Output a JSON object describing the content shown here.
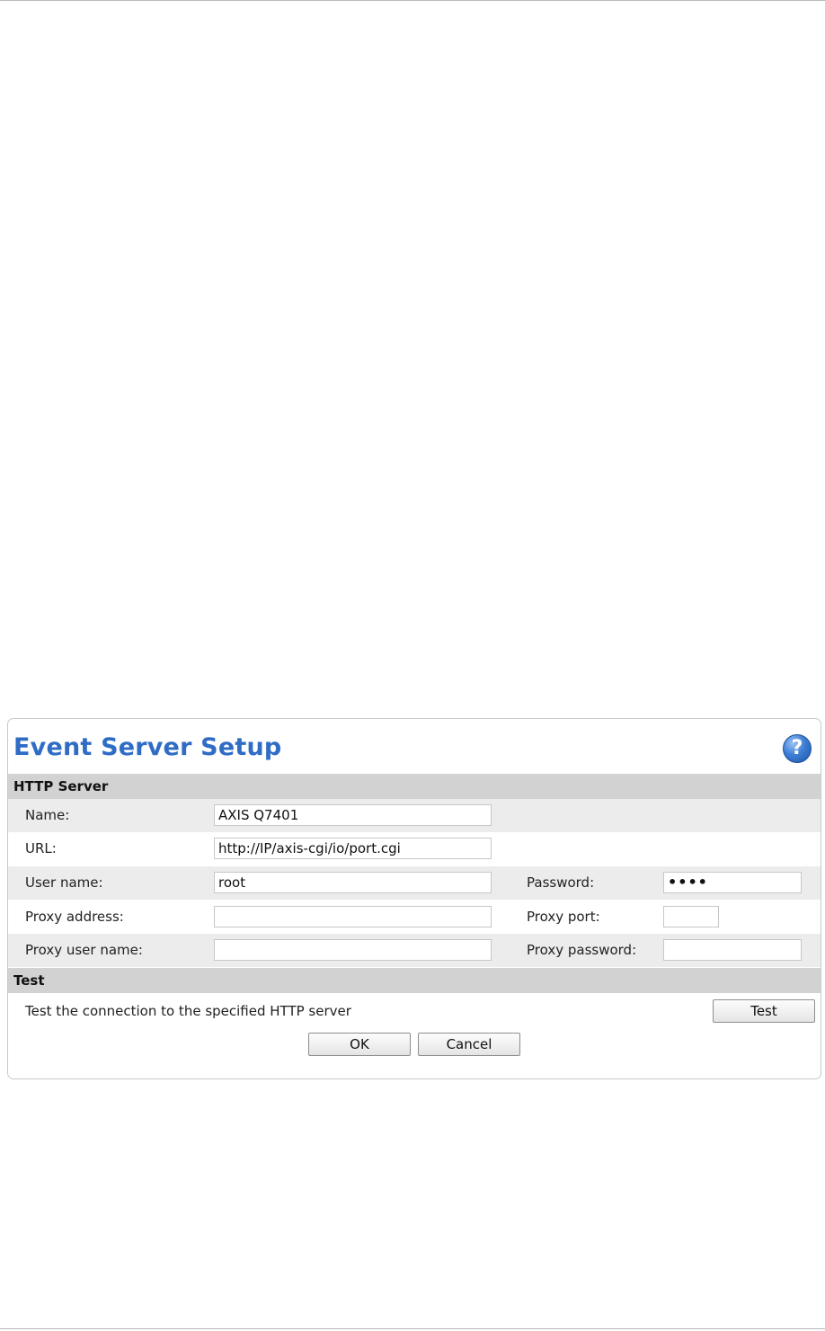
{
  "dialog": {
    "title": "Event Server Setup",
    "help_icon": "help-question-icon"
  },
  "http_server": {
    "heading": "HTTP Server",
    "name_label": "Name:",
    "name_value": "AXIS Q7401",
    "url_label": "URL:",
    "url_value": "http://IP/axis-cgi/io/port.cgi",
    "user_label": "User name:",
    "user_value": "root",
    "password_label": "Password:",
    "password_value": "••••",
    "proxy_address_label": "Proxy address:",
    "proxy_address_value": "",
    "proxy_port_label": "Proxy port:",
    "proxy_port_value": "",
    "proxy_user_label": "Proxy user name:",
    "proxy_user_value": "",
    "proxy_password_label": "Proxy password:",
    "proxy_password_value": ""
  },
  "test": {
    "heading": "Test",
    "description": "Test the connection to the specified HTTP server",
    "test_button": "Test"
  },
  "footer": {
    "ok_button": "OK",
    "cancel_button": "Cancel"
  },
  "colors": {
    "title": "#2f6cc5",
    "section_header_bg": "#d2d2d2",
    "row_shade_bg": "#ececec"
  }
}
